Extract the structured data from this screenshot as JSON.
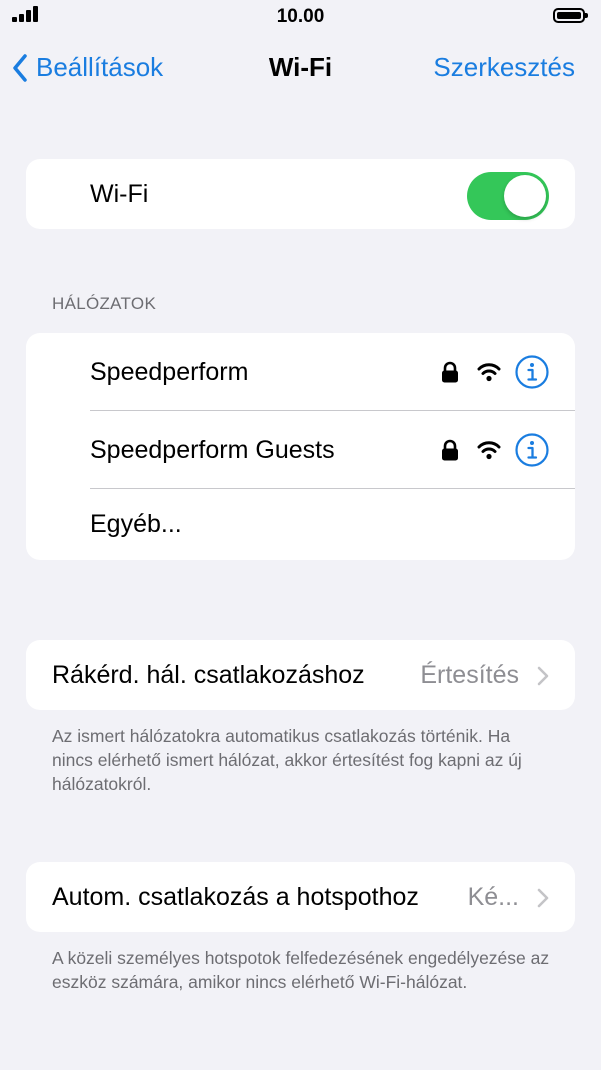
{
  "statusbar": {
    "time": "10.00"
  },
  "navbar": {
    "back_label": "Beállítások",
    "title": "Wi-Fi",
    "edit_label": "Szerkesztés"
  },
  "wifi": {
    "label": "Wi-Fi",
    "enabled": true,
    "accent": "#34c759"
  },
  "networks": {
    "header": "HÁLÓZATOK",
    "items": [
      {
        "name": "Speedperform",
        "secured": true
      },
      {
        "name": "Speedperform Guests",
        "secured": true
      }
    ],
    "other_label": "Egyéb..."
  },
  "ask_to_join": {
    "label": "Rákérd. hál. csatlakozáshoz",
    "value": "Értesítés",
    "footer": "Az ismert hálózatokra automatikus csatlakozás történik. Ha nincs elérhető ismert hálózat, akkor értesítést fog kapni az új hálózatokról."
  },
  "auto_hotspot": {
    "label": "Autom. csatlakozás a hotspothoz",
    "value": "Ké...",
    "footer": "A közeli személyes hotspotok felfedezésének engedélyezése az eszköz számára, amikor nincs elérhető Wi-Fi-hálózat."
  },
  "colors": {
    "link": "#1a7de0",
    "background": "#f2f2f7",
    "secondary_text": "#6d6d72"
  }
}
